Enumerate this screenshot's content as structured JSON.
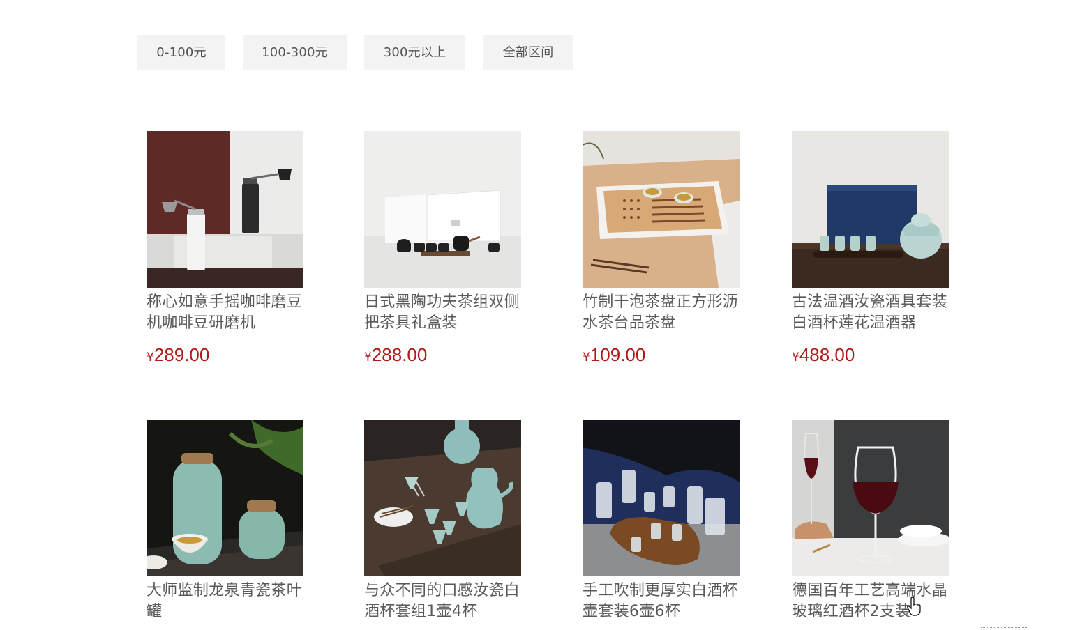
{
  "filters": [
    {
      "label": "0-100元"
    },
    {
      "label": "100-300元"
    },
    {
      "label": "300元以上"
    },
    {
      "label": "全部区间"
    }
  ],
  "currency_symbol": "¥",
  "products": [
    {
      "name": "称心如意手摇咖啡磨豆机咖啡豆研磨机",
      "price": "289.00",
      "image": "coffee-grinder-image"
    },
    {
      "name": "日式黑陶功夫茶组双侧把茶具礼盒装",
      "price": "288.00",
      "image": "black-tea-set-image"
    },
    {
      "name": "竹制干泡茶盘正方形沥水茶台品茶盘",
      "price": "109.00",
      "image": "bamboo-tea-tray-image"
    },
    {
      "name": "古法温酒汝瓷酒具套装白酒杯莲花温酒器",
      "price": "488.00",
      "image": "wine-warmer-set-image"
    },
    {
      "name": "大师监制龙泉青瓷茶叶罐",
      "image": "celadon-tea-jar-image"
    },
    {
      "name": "与众不同的口感汝瓷白酒杯套组1壶4杯",
      "image": "ru-porcelain-cup-set-image"
    },
    {
      "name": "手工吹制更厚实白酒杯壶套装6壶6杯",
      "image": "glass-liquor-set-image"
    },
    {
      "name": "德国百年工艺高端水晶玻璃红酒杯2支装",
      "image": "crystal-wine-glass-image"
    }
  ]
}
